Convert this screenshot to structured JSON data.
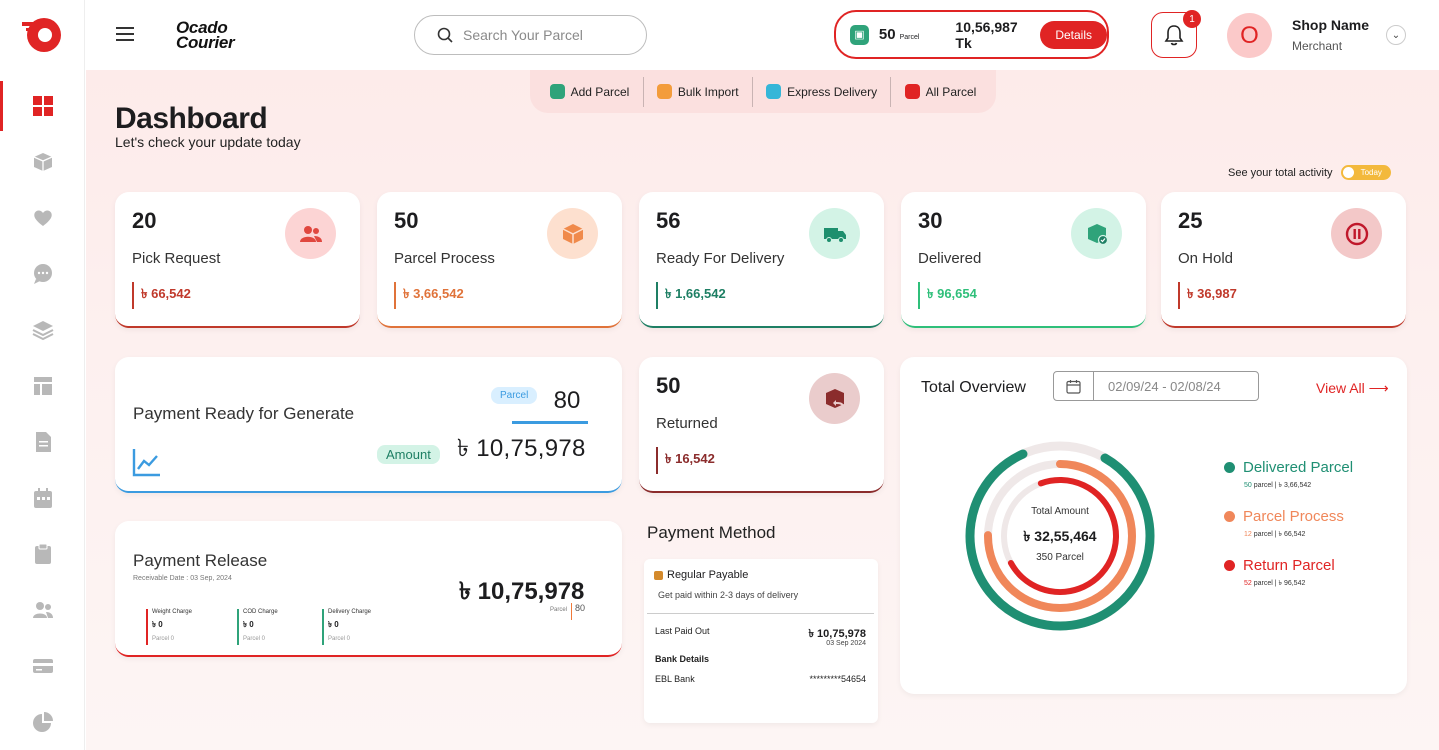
{
  "brand": {
    "line1": "Ocado",
    "line2": "Courier"
  },
  "search": {
    "placeholder": "Search Your Parcel"
  },
  "balance": {
    "count": "50",
    "unit": "Parcel",
    "amount": "10,56,987 Tk",
    "details_label": "Details"
  },
  "notifications": {
    "count": "1"
  },
  "user": {
    "initial": "O",
    "name": "Shop Name",
    "role": "Merchant"
  },
  "quick_actions": [
    {
      "label": "Add Parcel",
      "color": "#2fa37a"
    },
    {
      "label": "Bulk Import",
      "color": "#f39c3b"
    },
    {
      "label": "Express Delivery",
      "color": "#35b6d8"
    },
    {
      "label": "All Parcel",
      "color": "#e02424"
    }
  ],
  "page": {
    "title": "Dashboard",
    "subtitle": "Let's check your update today"
  },
  "activity": {
    "label": "See your total activity",
    "toggle": "Today"
  },
  "stats": [
    {
      "num": "20",
      "label": "Pick Request",
      "amount": "৳ 66,542",
      "color": "#c0392b"
    },
    {
      "num": "50",
      "label": "Parcel Process",
      "amount": "৳ 3,66,542",
      "color": "#e0733a"
    },
    {
      "num": "56",
      "label": "Ready For Delivery",
      "amount": "৳ 1,66,542",
      "color": "#1e7f64"
    },
    {
      "num": "30",
      "label": "Delivered",
      "amount": "৳ 96,654",
      "color": "#2fbf7a"
    },
    {
      "num": "25",
      "label": "On Hold",
      "amount": "৳ 36,987",
      "color": "#c0392b"
    }
  ],
  "payment_generate": {
    "title": "Payment Ready for Generate",
    "parcel_tag": "Parcel",
    "parcel_count": "80",
    "amount_tag": "Amount",
    "amount": "৳ 10,75,978"
  },
  "returned": {
    "num": "50",
    "label": "Returned",
    "amount": "৳ 16,542"
  },
  "payment_release": {
    "title": "Payment Release",
    "receivable": "Receivable Date : 03 Sep, 2024",
    "amount": "৳ 10,75,978",
    "parcel_label": "Parcel",
    "parcel_value": "80",
    "charges": [
      {
        "label": "Weight Charge",
        "value": "৳ 0",
        "parcel": "Parcel  0",
        "color": "#e02424"
      },
      {
        "label": "COD Charge",
        "value": "৳ 0",
        "parcel": "Parcel  0",
        "color": "#2fa37a"
      },
      {
        "label": "Delivery Charge",
        "value": "৳ 0",
        "parcel": "Parcel  0",
        "color": "#2fa37a"
      }
    ]
  },
  "payment_method": {
    "title": "Payment Method",
    "type": "Regular Payable",
    "desc": "Get paid within 2-3 days of delivery",
    "last_paid_label": "Last Paid Out",
    "last_paid_amount": "৳ 10,75,978",
    "last_paid_date": "03 Sep 2024",
    "bank_label": "Bank Details",
    "bank_name": "EBL Bank",
    "account": "*********54654"
  },
  "overview": {
    "title": "Total Overview",
    "date_range": "02/09/24 - 02/08/24",
    "view_all": "View All ⟶",
    "center_label": "Total Amount",
    "center_amount": "৳ 32,55,464",
    "center_parcels": "350 Parcel",
    "legend": [
      {
        "name": "Delivered Parcel",
        "parcels": "50",
        "amount": "parcel | ৳ 3,66,542",
        "color": "#1f8f73"
      },
      {
        "name": "Parcel Process",
        "parcels": "12",
        "amount": "parcel | ৳ 66,542",
        "color": "#f0875a"
      },
      {
        "name": "Return Parcel",
        "parcels": "52",
        "amount": "parcel | ৳ 96,542",
        "color": "#e02424"
      }
    ]
  },
  "sidebar_icons": [
    "dashboard-icon",
    "box-icon",
    "heart-icon",
    "chat-icon",
    "layers-icon",
    "layout-icon",
    "document-icon",
    "calendar-icon",
    "clipboard-icon",
    "users-icon",
    "card-icon",
    "pie-chart-icon"
  ]
}
